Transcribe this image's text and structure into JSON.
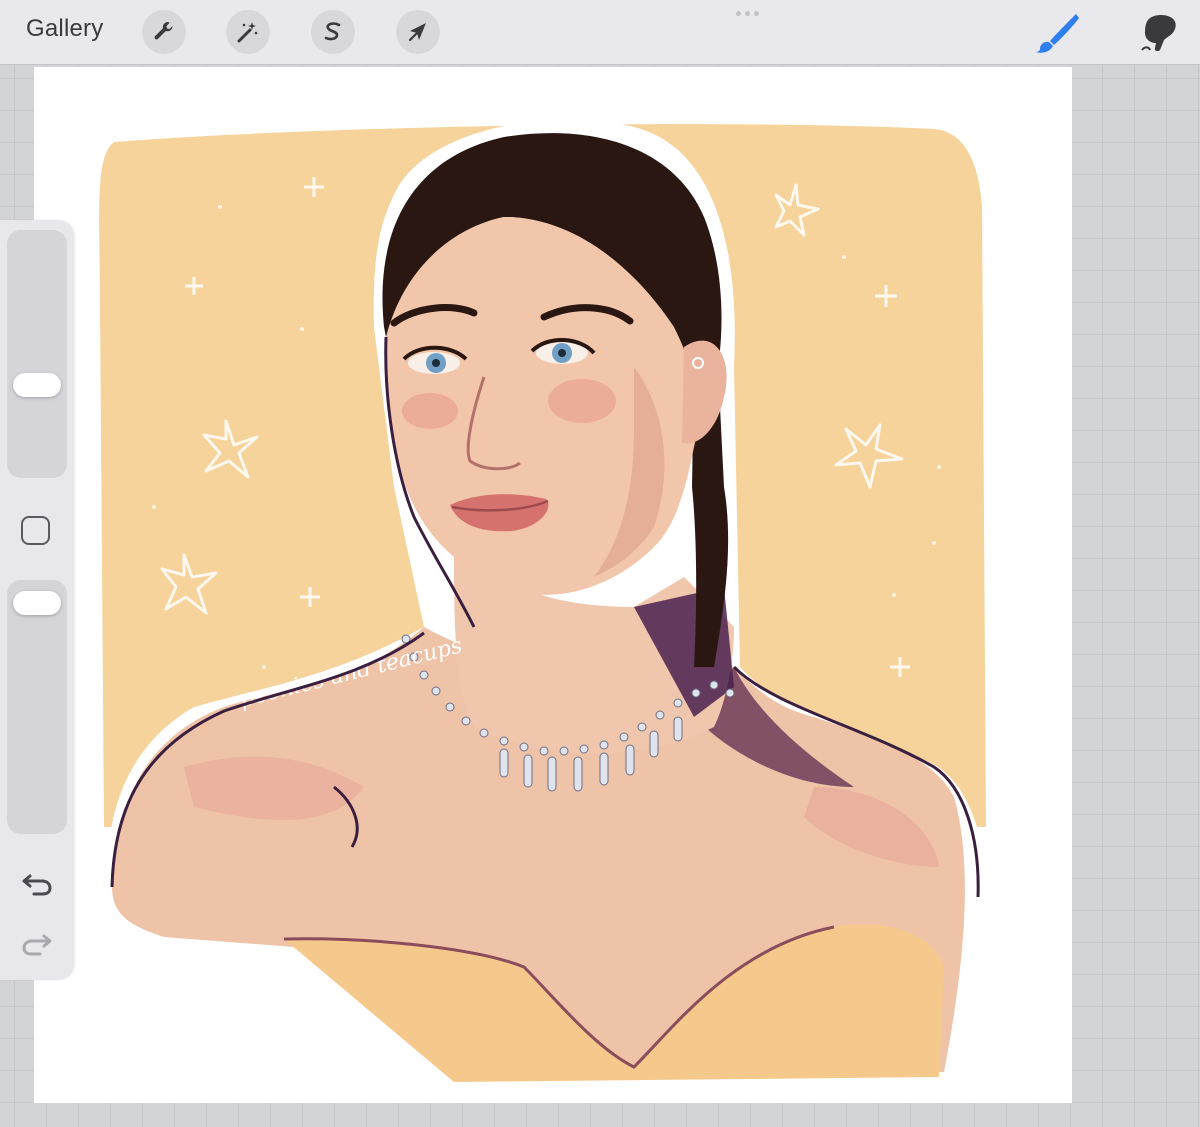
{
  "toolbar": {
    "gallery_label": "Gallery",
    "tools": [
      "wrench-icon",
      "magic-wand-icon",
      "selection-icon",
      "transform-arrow-icon"
    ],
    "active_tool": "brush",
    "accent_color": "#2f7ff0",
    "right_tools": [
      "brush-icon",
      "smudge-icon"
    ]
  },
  "sidebar": {
    "brush_size_level": 0.62,
    "opacity_level": 0.12,
    "controls": [
      "brush-size-slider",
      "modifier-button",
      "opacity-slider",
      "undo-icon",
      "redo-icon"
    ]
  },
  "canvas": {
    "background_color": "#ffffff",
    "panel_color": "#f6d39b",
    "watermark_text": "peonies and teacups",
    "subject": "portrait artwork"
  }
}
